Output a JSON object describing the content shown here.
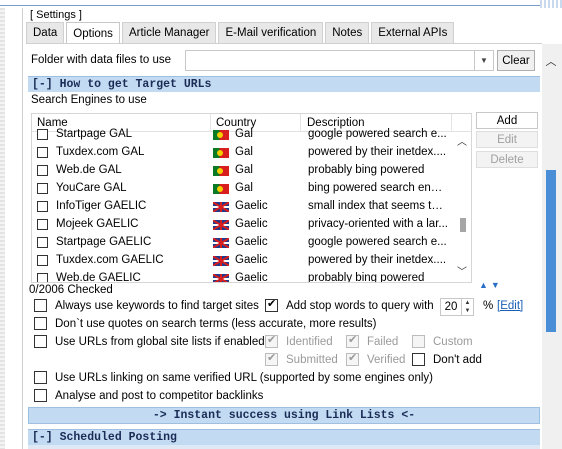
{
  "settings": {
    "legend": "[ Settings ]",
    "tabs": [
      {
        "label": "Data",
        "active": false
      },
      {
        "label": "Options",
        "active": true
      },
      {
        "label": "Article Manager",
        "active": false
      },
      {
        "label": "E-Mail verification",
        "active": false
      },
      {
        "label": "Notes",
        "active": false
      },
      {
        "label": "External APIs",
        "active": false
      }
    ]
  },
  "folder": {
    "label": "Folder with data files to use",
    "value": "",
    "clear_label": "Clear"
  },
  "sections": {
    "target_urls": "[-] How to get Target URLs",
    "scheduled_posting": "[-] Scheduled Posting"
  },
  "engines": {
    "label": "Search Engines to use",
    "columns": [
      "Name",
      "Country",
      "Description"
    ],
    "rows": [
      {
        "name": "Startpage GAL",
        "flag": "pt",
        "country": "Gal",
        "description": "google powered search e...",
        "checked": false
      },
      {
        "name": "Tuxdex.com GAL",
        "flag": "pt",
        "country": "Gal",
        "description": "powered by their inetdex....",
        "checked": false
      },
      {
        "name": "Web.de GAL",
        "flag": "pt",
        "country": "Gal",
        "description": "probably bing powered",
        "checked": false
      },
      {
        "name": "YouCare GAL",
        "flag": "pt",
        "country": "Gal",
        "description": "bing powered search engine",
        "checked": false
      },
      {
        "name": "InfoTiger GAELIC",
        "flag": "uk",
        "country": "Gaelic",
        "description": "small index that seems to ...",
        "checked": false
      },
      {
        "name": "Mojeek GAELIC",
        "flag": "uk",
        "country": "Gaelic",
        "description": "privacy-oriented with a lar...",
        "checked": false
      },
      {
        "name": "Startpage GAELIC",
        "flag": "uk",
        "country": "Gaelic",
        "description": "google powered search e...",
        "checked": false
      },
      {
        "name": "Tuxdex.com GAELIC",
        "flag": "uk",
        "country": "Gaelic",
        "description": "powered by their inetdex....",
        "checked": false
      },
      {
        "name": "Web.de GAELIC",
        "flag": "uk",
        "country": "Gaelic",
        "description": "probably bing powered",
        "checked": false
      }
    ],
    "checked_count": "0/2006 Checked",
    "buttons": {
      "add": "Add",
      "edit": "Edit",
      "delete": "Delete"
    }
  },
  "options": {
    "always_keywords": {
      "label": "Always use keywords to find target sites",
      "checked": false
    },
    "stop_words": {
      "label": "Add stop words to query with",
      "checked": true,
      "value": "20",
      "unit": "%",
      "edit_link": "[Edit]"
    },
    "no_quotes": {
      "label": "Don`t use quotes on search terms (less accurate, more results)",
      "checked": false
    },
    "global_lists": {
      "label": "Use URLs from global site lists if enabled",
      "checked": false
    },
    "global_identified": {
      "label": "Identified",
      "checked": true
    },
    "global_failed": {
      "label": "Failed",
      "checked": true
    },
    "global_custom": {
      "label": "Custom",
      "checked": false
    },
    "global_submitted": {
      "label": "Submitted",
      "checked": true
    },
    "global_verified": {
      "label": "Verified",
      "checked": true
    },
    "dont_add": {
      "label": "Don't add",
      "checked": false
    },
    "same_verified": {
      "label": "Use URLs linking on same verified URL (supported by some engines only)",
      "checked": false
    },
    "competitor": {
      "label": "Analyse and post to competitor backlinks",
      "checked": false
    }
  },
  "instant_success": "-> Instant success using Link Lists <-",
  "colors": {
    "section_bg": "#c3dbf2",
    "section_text": "#1a2b55",
    "scroll_thumb": "#4a8ed8",
    "link": "#1a5fb4"
  }
}
